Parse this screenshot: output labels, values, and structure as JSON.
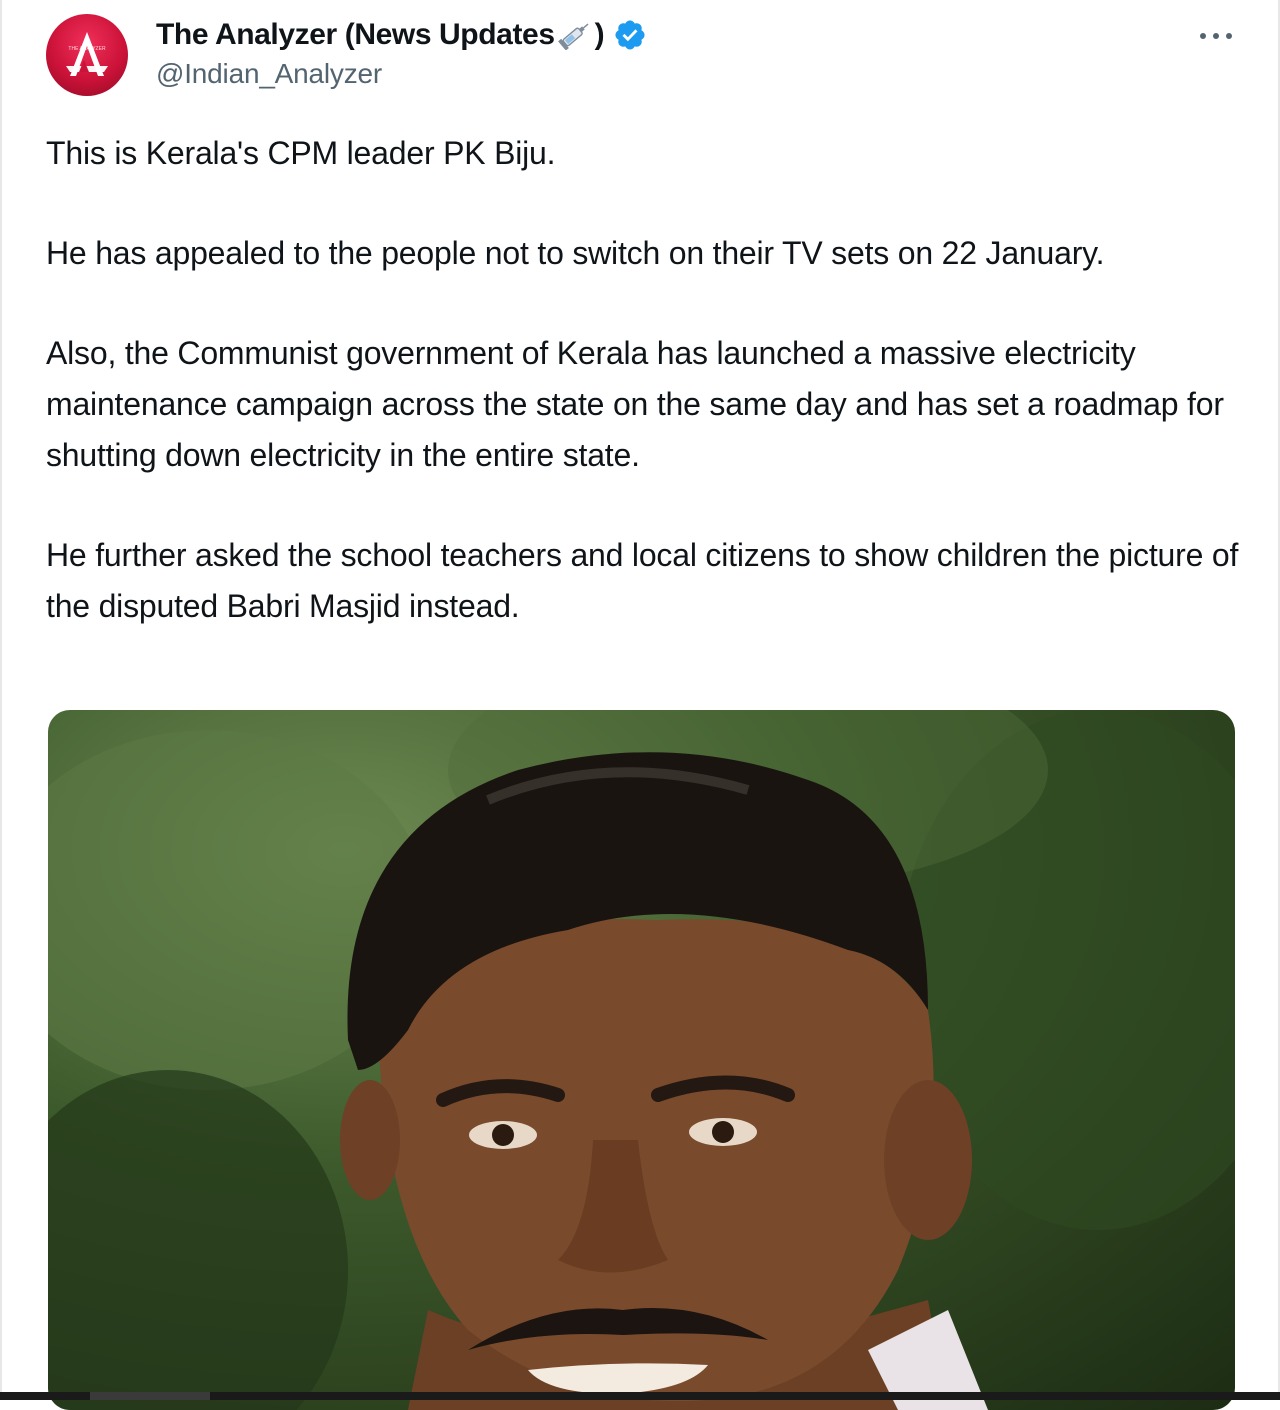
{
  "tweet": {
    "author": {
      "display_name": "The Analyzer (News Updates",
      "display_name_suffix": ")",
      "emoji_icon": "syringe-icon",
      "verified_icon": "verified-badge-icon",
      "verified_color": "#1d9bf0",
      "handle": "@Indian_Analyzer",
      "avatar_text": "THE ANALYZER",
      "avatar_color": "#cc1238"
    },
    "more_icon": "more-options-icon",
    "paragraphs": [
      "This is Kerala's CPM leader PK Biju.",
      "He has appealed to the people not to switch on their TV sets on 22 January.",
      "Also, the Communist government of Kerala has launched a massive electricity maintenance campaign across the state on the same day and has set a roadmap for shutting down electricity in the entire state.",
      "He further asked the school teachers and local citizens to show children the picture of the disputed Babri Masjid instead."
    ],
    "media": {
      "kind": "photo",
      "subject": "portrait-photo"
    }
  }
}
